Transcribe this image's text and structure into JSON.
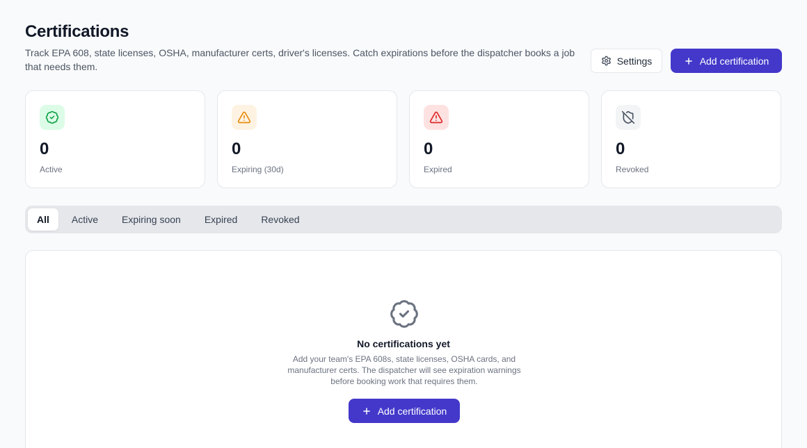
{
  "header": {
    "title": "Certifications",
    "subtitle": "Track EPA 608, state licenses, OSHA, manufacturer certs, driver's licenses. Catch expirations before the dispatcher books a job that needs them.",
    "settings_label": "Settings",
    "add_label": "Add certification"
  },
  "stats": [
    {
      "value": "0",
      "label": "Active",
      "icon": "badge-check-icon",
      "color": "#16a34a",
      "bg": "#dcfce7"
    },
    {
      "value": "0",
      "label": "Expiring (30d)",
      "icon": "warning-triangle-icon",
      "color": "#ea8a0c",
      "bg": "#fef3e2"
    },
    {
      "value": "0",
      "label": "Expired",
      "icon": "alert-triangle-icon",
      "color": "#dc2626",
      "bg": "#fee2e2"
    },
    {
      "value": "0",
      "label": "Revoked",
      "icon": "shield-off-icon",
      "color": "#4b5563",
      "bg": "#f3f4f6"
    }
  ],
  "tabs": [
    {
      "label": "All",
      "active": true
    },
    {
      "label": "Active",
      "active": false
    },
    {
      "label": "Expiring soon",
      "active": false
    },
    {
      "label": "Expired",
      "active": false
    },
    {
      "label": "Revoked",
      "active": false
    }
  ],
  "empty_state": {
    "icon": "badge-check-icon",
    "title": "No certifications yet",
    "description": "Add your team's EPA 608s, state licenses, OSHA cards, and manufacturer certs. The dispatcher will see expiration warnings before booking work that requires them.",
    "button_label": "Add certification"
  },
  "colors": {
    "primary": "#4338ca",
    "background": "#f9fafb",
    "border": "#e5e7eb"
  }
}
